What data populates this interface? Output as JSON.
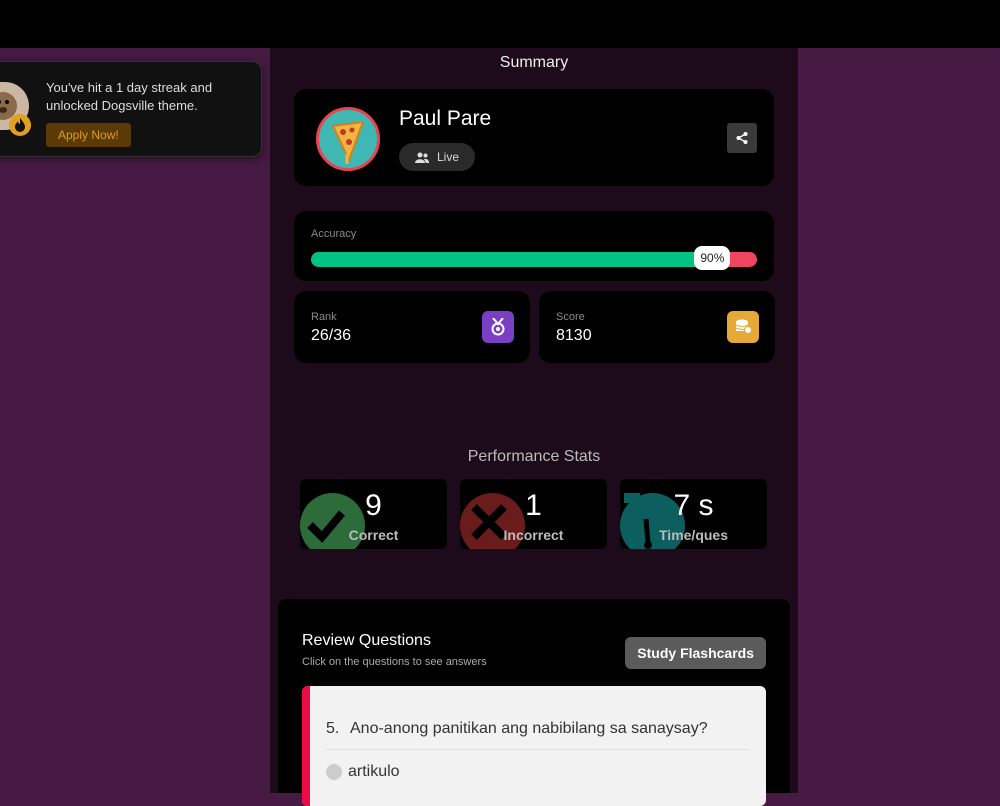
{
  "summary": {
    "title": "Summary"
  },
  "profile": {
    "name": "Paul Pare",
    "mode": "Live"
  },
  "accuracy": {
    "label": "Accuracy",
    "value_text": "90%",
    "fraction": 0.9
  },
  "rank": {
    "label": "Rank",
    "value": "26/36"
  },
  "score": {
    "label": "Score",
    "value": "8130"
  },
  "performance": {
    "title": "Performance Stats",
    "items": [
      {
        "value": "9",
        "label": "Correct",
        "color": "#2d6b3a"
      },
      {
        "value": "1",
        "label": "Incorrect",
        "color": "#6a1c1c"
      },
      {
        "value": "7 s",
        "label": "Time/ques",
        "color": "#0d5e5e"
      }
    ]
  },
  "review": {
    "title": "Review Questions",
    "subtitle": "Click on the questions to see answers",
    "flashcards_label": "Study Flashcards",
    "question": {
      "number": "5.",
      "text": "Ano-anong panitikan ang nabibilang sa sanaysay?",
      "option": "artikulo"
    }
  },
  "toast": {
    "message": "You've hit a 1 day streak and unlocked Dogsville theme.",
    "button": "Apply Now!"
  },
  "colors": {
    "accent_green": "#00c285",
    "accent_red": "#ec4660",
    "rank_icon": "#7a3fc4",
    "score_icon": "#e8a838"
  }
}
